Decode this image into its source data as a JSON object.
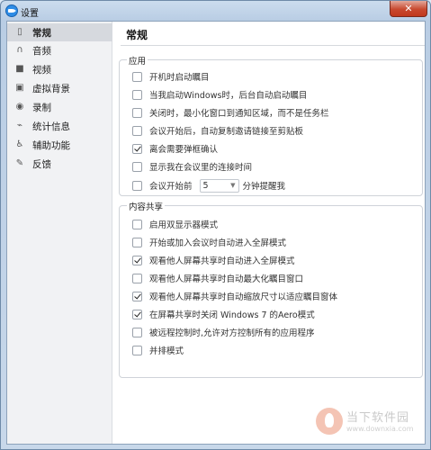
{
  "window": {
    "title": "设置",
    "close_label": "✕"
  },
  "sidebar": {
    "items": [
      {
        "label": "常规",
        "icon": "phone-icon",
        "glyph": "▯",
        "active": true
      },
      {
        "label": "音频",
        "icon": "headphones-icon",
        "glyph": "∩",
        "active": false
      },
      {
        "label": "视频",
        "icon": "camera-icon",
        "glyph": "■",
        "active": false
      },
      {
        "label": "虚拟背景",
        "icon": "image-icon",
        "glyph": "▣",
        "active": false
      },
      {
        "label": "录制",
        "icon": "record-icon",
        "glyph": "◉",
        "active": false
      },
      {
        "label": "统计信息",
        "icon": "stats-icon",
        "glyph": "⌁",
        "active": false
      },
      {
        "label": "辅助功能",
        "icon": "accessibility-icon",
        "glyph": "♿",
        "active": false
      },
      {
        "label": "反馈",
        "icon": "feedback-icon",
        "glyph": "✎",
        "active": false
      }
    ]
  },
  "main": {
    "title": "常规",
    "app_group": {
      "label": "应用",
      "options": [
        {
          "label": "开机时启动瞩目",
          "checked": false
        },
        {
          "label": "当我启动Windows时，后台自动启动瞩目",
          "checked": false
        },
        {
          "label": "关闭时，最小化窗口到通知区域，而不是任务栏",
          "checked": false
        },
        {
          "label": "会议开始后，自动复制邀请链接至剪贴板",
          "checked": false
        },
        {
          "label": "离会需要弹框确认",
          "checked": true
        },
        {
          "label": "显示我在会议里的连接时间",
          "checked": false
        }
      ],
      "reminder": {
        "prefix": "会议开始前",
        "value": "5",
        "suffix": "分钟提醒我",
        "checked": false
      }
    },
    "share_group": {
      "label": "内容共享",
      "options": [
        {
          "label": "启用双显示器模式",
          "checked": false
        },
        {
          "label": "开始或加入会议时自动进入全屏模式",
          "checked": false
        },
        {
          "label": "观看他人屏幕共享时自动进入全屏模式",
          "checked": true
        },
        {
          "label": "观看他人屏幕共享时自动最大化瞩目窗口",
          "checked": false
        },
        {
          "label": "观看他人屏幕共享时自动缩放尺寸以适应瞩目窗体",
          "checked": true
        },
        {
          "label": "在屏幕共享时关闭 Windows 7 的Aero模式",
          "checked": true
        },
        {
          "label": "被远程控制时,允许对方控制所有的应用程序",
          "checked": false
        },
        {
          "label": "并排模式",
          "checked": false
        }
      ]
    }
  },
  "watermark": {
    "cn": "当下软件园",
    "en": "www.downxia.com"
  }
}
